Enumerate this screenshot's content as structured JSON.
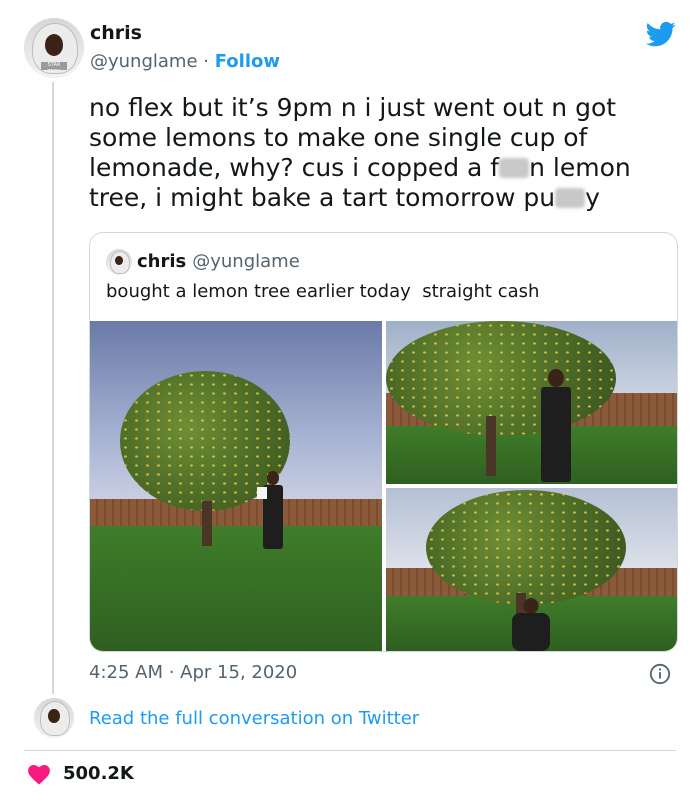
{
  "tweet": {
    "author_name": "chris",
    "author_handle": "@yunglame",
    "separator": " · ",
    "follow_label": "Follow",
    "text_parts": [
      "no flex but it’s 9pm n i just went out n got some lemons to make one single cup of lemonade, why? cus i copped a f",
      "n lemon tree, i might bake a tart tomorrow pu",
      "y"
    ],
    "time": "4:25 AM",
    "date_separator": " · ",
    "date": "Apr 15, 2020",
    "read_conversation": "Read the full conversation on Twitter",
    "likes": "500.2K",
    "avatar_badge": "STAR TREK"
  },
  "quoted_tweet": {
    "author_name": "chris",
    "author_handle": "@yunglame",
    "text": "bought a lemon tree earlier today  straight cash",
    "photos": [
      "lemon tree in a backyard, person standing holding a paper",
      "person posing under lemon tree",
      "person crouching under lemon tree"
    ]
  },
  "icons": {
    "brand": "twitter-bird-icon",
    "info": "info-icon",
    "like": "heart-icon"
  },
  "colors": {
    "accent": "#1d9bf0",
    "like": "#f91880",
    "muted": "#536471",
    "border": "#cfd9de"
  }
}
